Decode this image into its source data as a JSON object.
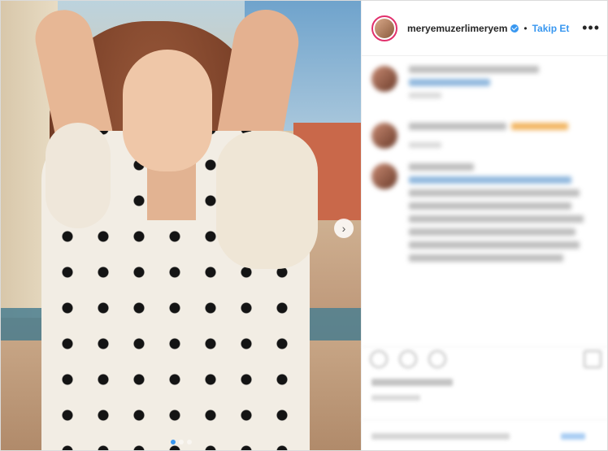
{
  "post": {
    "username": "meryemuzerlimeryem",
    "separator": "•",
    "follow_label": "Takip Et",
    "more_label": "•••",
    "next_label": "›",
    "carousel_dots": 3,
    "active_dot": 0
  },
  "icons": {
    "verified": "verified-badge-icon",
    "next": "chevron-right-icon",
    "more": "more-options-icon"
  },
  "colors": {
    "accent": "#3897f0",
    "story_ring": "#e1306c"
  }
}
